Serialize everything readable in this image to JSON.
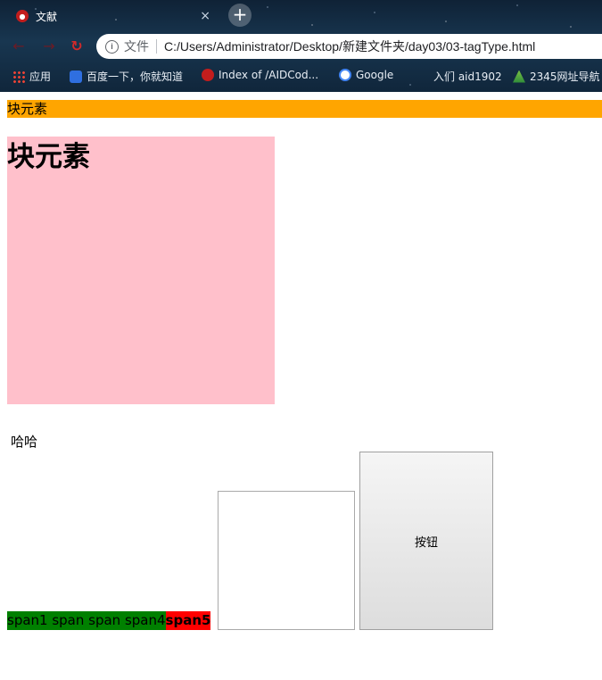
{
  "browser": {
    "tab_title": "文献",
    "tab_close": "×",
    "new_tab": "+",
    "back": "←",
    "forward": "→",
    "reload": "↻",
    "info": "i",
    "scheme_label": "文件",
    "url": "C:/Users/Administrator/Desktop/新建文件夹/day03/03-tagType.html",
    "bookmarks": [
      "应用",
      "百度一下，你就知道",
      "Index of /AIDCod...",
      "Google",
      "入们 aid1902",
      "2345网址导航"
    ]
  },
  "page": {
    "block_bar_text": "块元素",
    "heading": "块元素",
    "haha": "哈哈",
    "spans_text": "span1 span span span4",
    "span5": "span5",
    "button_label": "按钮"
  },
  "colors": {
    "block_bar": "#ffa500",
    "pink_box": "#ffc0cb",
    "spans_bg": "#008000",
    "span5_bg": "#ff0000"
  }
}
